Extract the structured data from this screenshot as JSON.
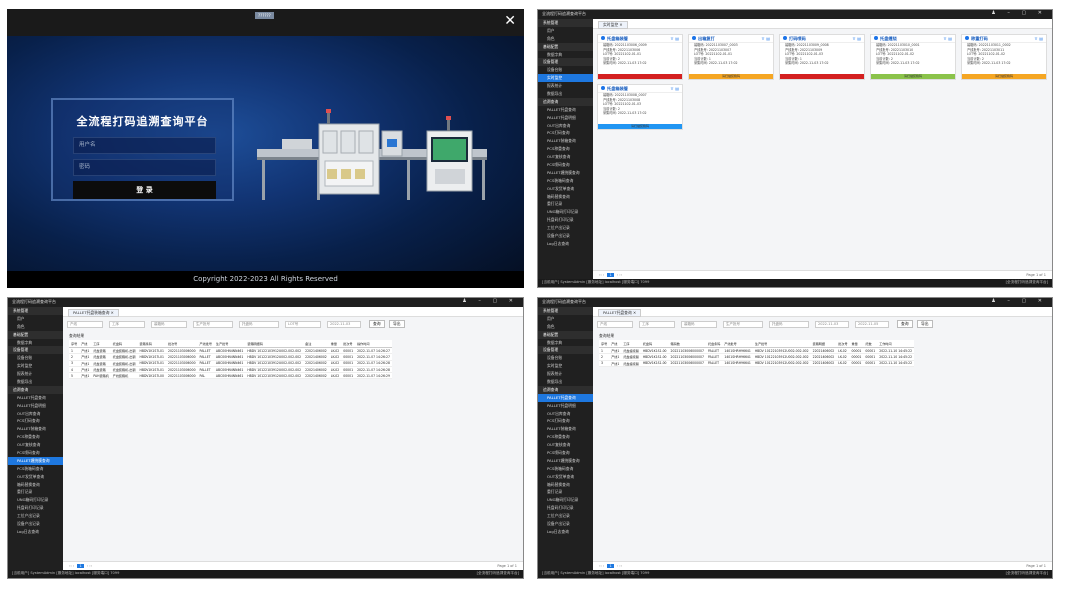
{
  "login": {
    "badge": "??????",
    "close_icon": "close-icon",
    "title": "全流程打码追溯查询平台",
    "username_placeholder": "用户名",
    "password_placeholder": "密码",
    "login_button": "登 录",
    "footer": "Copyright  2022-2023 All Rights Reserved"
  },
  "app": {
    "window_title": "全流程打码追溯查询平台",
    "status_left": "[当前用户] SystemAdmin  [服务地址] localhost  [服务端口] 7099",
    "status_right": "[全流程打码追溯查询平台]",
    "sidebar_items": [
      {
        "label": "系统管理",
        "type": "sec"
      },
      {
        "label": "用户",
        "type": "sub"
      },
      {
        "label": "角色",
        "type": "sub"
      },
      {
        "label": "基础配置",
        "type": "sec"
      },
      {
        "label": "数据字典",
        "type": "sub"
      },
      {
        "label": "设备管理",
        "type": "sec"
      },
      {
        "label": "设备台账",
        "type": "sub"
      },
      {
        "label": "实时监控",
        "type": "sub"
      },
      {
        "label": "报表统计",
        "type": "sub"
      },
      {
        "label": "数据导出",
        "type": "sub"
      },
      {
        "label": "追溯查询",
        "type": "sec"
      },
      {
        "label": "PALLET托盘查询",
        "type": "sub"
      },
      {
        "label": "PALLET托盘明细",
        "type": "sub"
      },
      {
        "label": "OUT出库查询",
        "type": "sub"
      },
      {
        "label": "PCS打码查询",
        "type": "sub"
      },
      {
        "label": "PALLET装箱查询",
        "type": "sub"
      },
      {
        "label": "PCS称重查询",
        "type": "sub"
      },
      {
        "label": "OUT复核查询",
        "type": "sub"
      },
      {
        "label": "PCS喷码查询",
        "type": "sub"
      },
      {
        "label": "PALLET缠绕膜查询",
        "type": "sub"
      },
      {
        "label": "PCS装箱码查询",
        "type": "sub"
      },
      {
        "label": "OUT发货单查询",
        "type": "sub"
      },
      {
        "label": "箱码替换查询",
        "type": "sub"
      },
      {
        "label": "重打记录",
        "type": "sub"
      },
      {
        "label": "UNG箱码打印记录",
        "type": "sub"
      },
      {
        "label": "托盘码打印记录",
        "type": "sub"
      },
      {
        "label": "工位产出记录",
        "type": "sub"
      },
      {
        "label": "设备产出记录",
        "type": "sub"
      },
      {
        "label": "Log日志查询",
        "type": "sub"
      }
    ]
  },
  "monitor": {
    "tab": "实时监控",
    "pager": "1",
    "page_info": "Page 1 of 1",
    "cards": [
      {
        "title": "托盘箱装管",
        "row1": "装箱码: 20221103006_0009",
        "row2": "产线批号: 20221103006",
        "row3": "LOT号: 20221102-01-01",
        "row4": "当前计数: 2",
        "row5": "采集时间: 2022-11-03 17:02",
        "bar": "",
        "bar_color": "#d42020"
      },
      {
        "title": "出箱复打",
        "row1": "装箱码: 20221103007_0003",
        "row2": "产线批号: 20221103007",
        "row3": "LOT号: 20221102-01-01",
        "row4": "当前计数: 1",
        "row5": "采集时间: 2022-11-03 17:02",
        "bar": "请扫描装箱码",
        "bar_color": "#f5a623"
      },
      {
        "title": "打码喷码",
        "row1": "装箱码: 20221103009_0008",
        "row2": "产线批号: 20221103009",
        "row3": "LOT号: 20221102-01-03",
        "row4": "当前计数: 1",
        "row5": "采集时间: 2022-11-03 17:02",
        "bar": "",
        "bar_color": "#d42020"
      },
      {
        "title": "托盘缠绕",
        "row1": "装箱码: 20221103010_0001",
        "row2": "产线批号: 20221103010",
        "row3": "LOT号: 20221102-01-02",
        "row4": "当前计数: 2",
        "row5": "采集时间: 2022-11-03 17:02",
        "bar": "请扫描装箱码",
        "bar_color": "#8bc34a"
      },
      {
        "title": "称重打码",
        "row1": "装箱码: 20221103011_0002",
        "row2": "产线批号: 20221103011",
        "row3": "LOT号: 20221102-01-02",
        "row4": "当前计数: 2",
        "row5": "采集时间: 2022-11-03 17:02",
        "bar": "请扫描装箱码",
        "bar_color": "#f5a623"
      },
      {
        "title": "托盘箱装管",
        "row1": "装箱码: 20221103008_0007",
        "row2": "产线批号: 20221103008",
        "row3": "LOT号: 20221102-01-03",
        "row4": "当前计数: 2",
        "row5": "采集时间: 2022-11-03 17:02",
        "bar": "请扫描装箱码",
        "bar_color": "#2196f3"
      }
    ]
  },
  "query1": {
    "tab": "PALLET托盘装箱查询",
    "filter_1": "产线",
    "filter_2": "工序",
    "filter_3": "装箱码",
    "filter_4": "生产批号",
    "filter_5": "托盘码",
    "filter_6": "LOT号",
    "filter_7": "2022-11-03",
    "search": "查询",
    "export": "导出",
    "section": "查询结果",
    "headers": [
      "序号",
      "产线",
      "工序",
      "托盘码",
      "装箱条码",
      "批次号",
      "产线批号",
      "生产批号",
      "装箱明细码",
      "备注",
      "重量",
      "批次号",
      "操作时间"
    ],
    "rows": [
      [
        "1",
        "产线1",
        "托盘装箱",
        "托盘装箱机-出钢",
        "HBDV1K1S7L01",
        "20221103006000",
        "PALLET",
        "ABC00HN4NN461",
        "HBDV 10122103912U002-002-002",
        "22021406002",
        "LK-02",
        "00001",
        "2022-11-07 14:26:27"
      ],
      [
        "2",
        "产线1",
        "托盘装箱",
        "托盘装箱机-出钢",
        "HBDV1K1S7L01",
        "20221103006000",
        "PALLET",
        "ABC00HN4NN461",
        "HBDV 10122103912U002-002-002",
        "22021406002",
        "LK-02",
        "00001",
        "2022-11-07 14:26:27"
      ],
      [
        "3",
        "产线1",
        "托盘装箱",
        "托盘装箱机-出钢",
        "HBDV1K1S7L01",
        "20221103006000",
        "PALLET",
        "ABC00HN4NN461",
        "HBDV 10122103912U002-002-002",
        "22021406002",
        "LK-02",
        "00001",
        "2022-11-07 14:26:28"
      ],
      [
        "4",
        "产线1",
        "托盘装箱",
        "托盘装箱机-出钢",
        "HBDV1K1S7L01",
        "20221103006000",
        "PALLET",
        "ABC00HN4NN461",
        "HBDV 10122103912U002-002-002",
        "22021406002",
        "LK-02",
        "00001",
        "2022-11-07 14:26:28"
      ],
      [
        "5",
        "产线1",
        "PAH装箱机",
        "产线装箱机",
        "HBDV1K1S7L00",
        "20221103006000",
        "PAL",
        "ABC00HN4NN461",
        "HBDV 10122103912U002-002-002",
        "22021406002",
        "LK-02",
        "00001",
        "2022-11-07 14:26:29"
      ]
    ],
    "pager": "1",
    "page_info": "Page 1 of 1"
  },
  "query2": {
    "tab": "PALLET托盘查询",
    "filter_1": "产线",
    "filter_2": "工序",
    "filter_3": "装箱码",
    "filter_4": "生产批号",
    "filter_5": "托盘码",
    "filter_6": "2022-11-03",
    "filter_7": "2022-11-05",
    "search": "查询",
    "export": "导出",
    "section": "查询结果",
    "headers": [
      "序号",
      "产线",
      "工序",
      "托盘码",
      "箱码数",
      "托盘条码",
      "产线批号",
      "生产批号",
      "装箱明细",
      "批次号",
      "重量",
      "托数",
      "工作时间"
    ],
    "rows": [
      [
        "1",
        "产线1",
        "托盘缠绕膜",
        "HBDV1K1S1.00",
        "20221103006000007",
        "PALLET",
        "1401SHRH96641",
        "HBDV 10122103912U002-002-002",
        "22021406002",
        "LK-02",
        "00001",
        "00001",
        "2022-11-10 14:45:22"
      ],
      [
        "2",
        "产线1",
        "托盘缠绕膜",
        "HBDV1K1S1.00",
        "20221103006000007",
        "PALLET",
        "1401SHRH96641",
        "HBDV 10122103912U002-002-002",
        "22021406002",
        "LK-02",
        "00001",
        "00001",
        "2022-11-10 14:45:22"
      ],
      [
        "3",
        "产线1",
        "托盘缠绕膜",
        "HBDV1K1S1.00",
        "20221103006000007",
        "PALLET",
        "1401SHRH96641",
        "HBDV 10122103912U002-002-002",
        "22021406002",
        "LK-02",
        "00001",
        "00001",
        "2022-11-10 14:45:22"
      ]
    ],
    "pager": "1",
    "page_info": "Page 1 of 1"
  }
}
